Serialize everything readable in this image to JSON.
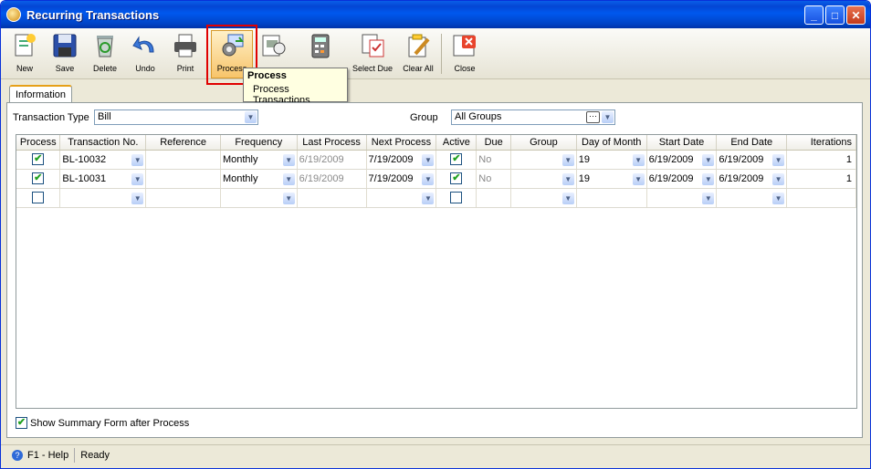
{
  "window": {
    "title": "Recurring Transactions"
  },
  "toolbar": {
    "new": "New",
    "save": "Save",
    "delete": "Delete",
    "undo": "Undo",
    "print": "Print",
    "process": "Process",
    "select_due": "Select Due",
    "clear_all": "Clear All",
    "close": "Close"
  },
  "tooltip": {
    "title": "Process",
    "desc": "Process Transactions"
  },
  "tab": {
    "label": "Information"
  },
  "filters": {
    "transaction_type_label": "Transaction Type",
    "transaction_type_value": "Bill",
    "group_label": "Group",
    "group_value": "All Groups"
  },
  "grid": {
    "columns": [
      "Process",
      "Transaction No.",
      "Reference",
      "Frequency",
      "Last Process",
      "Next Process",
      "Active",
      "Due",
      "Group",
      "Day of Month",
      "Start Date",
      "End Date",
      "Iterations"
    ],
    "rows": [
      {
        "process": true,
        "transaction_no": "BL-10032",
        "reference": "",
        "frequency": "Monthly",
        "last_process": "6/19/2009",
        "next_process": "7/19/2009",
        "active": true,
        "due": "No",
        "group": "",
        "day_of_month": "19",
        "start_date": "6/19/2009",
        "end_date": "6/19/2009",
        "iterations": "1"
      },
      {
        "process": true,
        "transaction_no": "BL-10031",
        "reference": "",
        "frequency": "Monthly",
        "last_process": "6/19/2009",
        "next_process": "7/19/2009",
        "active": true,
        "due": "No",
        "group": "",
        "day_of_month": "19",
        "start_date": "6/19/2009",
        "end_date": "6/19/2009",
        "iterations": "1"
      }
    ]
  },
  "summary": {
    "label": "Show Summary Form after Process"
  },
  "status": {
    "help": "F1 - Help",
    "state": "Ready"
  }
}
